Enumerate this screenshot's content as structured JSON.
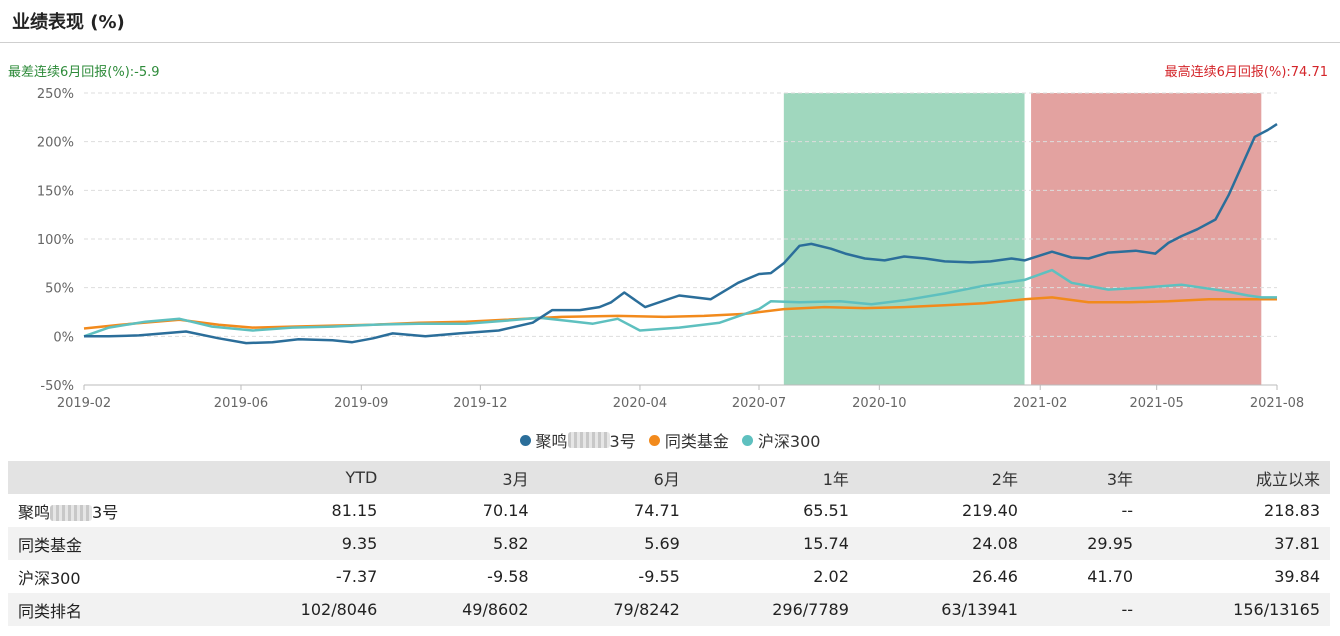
{
  "header": {
    "title": "业绩表现 (%)"
  },
  "stats": {
    "worst": "最差连续6月回报(%):-5.9",
    "best": "最高连续6月回报(%):74.71"
  },
  "chart_data": {
    "type": "line",
    "x_ticks": [
      "2019-02",
      "2019-06",
      "2019-09",
      "2019-12",
      "2020-04",
      "2020-07",
      "2020-10",
      "2021-02",
      "2021-05",
      "2021-08"
    ],
    "x_range": [
      "2019-02-01",
      "2021-08-01"
    ],
    "y_ticks": [
      "250%",
      "200%",
      "150%",
      "100%",
      "50%",
      "0%",
      "-50%"
    ],
    "ylim": [
      -50,
      250
    ],
    "grid": true,
    "legend_position": "bottom-center",
    "shaded_regions": [
      {
        "kind": "worst-6-month",
        "start": "2020-07-20",
        "end": "2021-01-20",
        "color": "#a0d7be"
      },
      {
        "kind": "best-6-month",
        "start": "2021-01-25",
        "end": "2021-07-20",
        "color": "#e3a2a0"
      }
    ],
    "series": [
      {
        "name": "聚鸣",
        "name_suffix": "3号",
        "color": "#2b6e9a",
        "points": [
          [
            "2019-02-01",
            0
          ],
          [
            "2019-02-20",
            0
          ],
          [
            "2019-03-15",
            1
          ],
          [
            "2019-04-20",
            5
          ],
          [
            "2019-05-15",
            -2
          ],
          [
            "2019-06-05",
            -7
          ],
          [
            "2019-06-25",
            -6
          ],
          [
            "2019-07-15",
            -3
          ],
          [
            "2019-08-10",
            -4
          ],
          [
            "2019-08-25",
            -6
          ],
          [
            "2019-09-10",
            -2
          ],
          [
            "2019-09-25",
            3
          ],
          [
            "2019-10-20",
            0
          ],
          [
            "2019-11-15",
            3
          ],
          [
            "2019-12-15",
            6
          ],
          [
            "2020-01-10",
            14
          ],
          [
            "2020-01-25",
            27
          ],
          [
            "2020-02-15",
            27
          ],
          [
            "2020-03-01",
            30
          ],
          [
            "2020-03-10",
            35
          ],
          [
            "2020-03-20",
            45
          ],
          [
            "2020-04-05",
            30
          ],
          [
            "2020-05-01",
            42
          ],
          [
            "2020-05-25",
            38
          ],
          [
            "2020-06-15",
            55
          ],
          [
            "2020-07-01",
            64
          ],
          [
            "2020-07-10",
            65
          ],
          [
            "2020-07-20",
            75
          ],
          [
            "2020-08-01",
            93
          ],
          [
            "2020-08-10",
            95
          ],
          [
            "2020-08-25",
            90
          ],
          [
            "2020-09-05",
            85
          ],
          [
            "2020-09-20",
            80
          ],
          [
            "2020-10-05",
            78
          ],
          [
            "2020-10-20",
            82
          ],
          [
            "2020-11-05",
            80
          ],
          [
            "2020-11-20",
            77
          ],
          [
            "2020-12-10",
            76
          ],
          [
            "2020-12-25",
            77
          ],
          [
            "2021-01-10",
            80
          ],
          [
            "2021-01-20",
            78
          ],
          [
            "2021-02-10",
            87
          ],
          [
            "2021-02-25",
            81
          ],
          [
            "2021-03-10",
            80
          ],
          [
            "2021-03-25",
            86
          ],
          [
            "2021-04-15",
            88
          ],
          [
            "2021-04-30",
            85
          ],
          [
            "2021-05-10",
            96
          ],
          [
            "2021-05-20",
            103
          ],
          [
            "2021-06-01",
            110
          ],
          [
            "2021-06-15",
            120
          ],
          [
            "2021-06-25",
            145
          ],
          [
            "2021-07-05",
            175
          ],
          [
            "2021-07-15",
            205
          ],
          [
            "2021-07-25",
            212
          ],
          [
            "2021-08-01",
            218
          ]
        ]
      },
      {
        "name": "同类基金",
        "color": "#f28a1c",
        "points": [
          [
            "2019-02-01",
            8
          ],
          [
            "2019-03-01",
            12
          ],
          [
            "2019-04-15",
            17
          ],
          [
            "2019-05-15",
            12
          ],
          [
            "2019-06-10",
            9
          ],
          [
            "2019-07-10",
            10
          ],
          [
            "2019-08-10",
            11
          ],
          [
            "2019-09-10",
            12
          ],
          [
            "2019-10-15",
            14
          ],
          [
            "2019-11-20",
            15
          ],
          [
            "2019-12-20",
            17
          ],
          [
            "2020-02-01",
            20
          ],
          [
            "2020-03-15",
            21
          ],
          [
            "2020-04-20",
            20
          ],
          [
            "2020-05-20",
            21
          ],
          [
            "2020-06-20",
            23
          ],
          [
            "2020-07-20",
            28
          ],
          [
            "2020-08-20",
            30
          ],
          [
            "2020-09-20",
            29
          ],
          [
            "2020-10-20",
            30
          ],
          [
            "2020-11-20",
            32
          ],
          [
            "2020-12-20",
            34
          ],
          [
            "2021-01-20",
            38
          ],
          [
            "2021-02-10",
            40
          ],
          [
            "2021-03-10",
            35
          ],
          [
            "2021-04-10",
            35
          ],
          [
            "2021-05-10",
            36
          ],
          [
            "2021-06-10",
            38
          ],
          [
            "2021-07-10",
            38
          ],
          [
            "2021-08-01",
            38
          ]
        ]
      },
      {
        "name": "沪深300",
        "color": "#5ec0bf",
        "points": [
          [
            "2019-02-01",
            0
          ],
          [
            "2019-02-20",
            9
          ],
          [
            "2019-03-20",
            15
          ],
          [
            "2019-04-15",
            18
          ],
          [
            "2019-05-10",
            10
          ],
          [
            "2019-06-10",
            6
          ],
          [
            "2019-07-10",
            9
          ],
          [
            "2019-08-10",
            10
          ],
          [
            "2019-09-10",
            12
          ],
          [
            "2019-10-15",
            13
          ],
          [
            "2019-11-20",
            13
          ],
          [
            "2019-12-20",
            16
          ],
          [
            "2020-01-15",
            19
          ],
          [
            "2020-02-05",
            16
          ],
          [
            "2020-02-25",
            13
          ],
          [
            "2020-03-15",
            18
          ],
          [
            "2020-04-01",
            6
          ],
          [
            "2020-05-01",
            9
          ],
          [
            "2020-06-01",
            14
          ],
          [
            "2020-07-01",
            28
          ],
          [
            "2020-07-10",
            36
          ],
          [
            "2020-08-01",
            35
          ],
          [
            "2020-09-01",
            36
          ],
          [
            "2020-09-25",
            33
          ],
          [
            "2020-10-20",
            37
          ],
          [
            "2020-11-20",
            44
          ],
          [
            "2020-12-20",
            52
          ],
          [
            "2021-01-20",
            58
          ],
          [
            "2021-02-10",
            68
          ],
          [
            "2021-02-25",
            55
          ],
          [
            "2021-03-25",
            48
          ],
          [
            "2021-04-20",
            50
          ],
          [
            "2021-05-20",
            53
          ],
          [
            "2021-06-20",
            47
          ],
          [
            "2021-07-10",
            42
          ],
          [
            "2021-07-20",
            40
          ],
          [
            "2021-08-01",
            40
          ]
        ]
      }
    ]
  },
  "table": {
    "headers": [
      "",
      "YTD",
      "3月",
      "6月",
      "1年",
      "2年",
      "3年",
      "成立以来"
    ],
    "rows": [
      {
        "name": "聚鸣",
        "name_suffix": "3号",
        "values": [
          "81.15",
          "70.14",
          "74.71",
          "65.51",
          "219.40",
          "--",
          "218.83"
        ]
      },
      {
        "name": "同类基金",
        "values": [
          "9.35",
          "5.82",
          "5.69",
          "15.74",
          "24.08",
          "29.95",
          "37.81"
        ]
      },
      {
        "name": "沪深300",
        "values": [
          "-7.37",
          "-9.58",
          "-9.55",
          "2.02",
          "26.46",
          "41.70",
          "39.84"
        ]
      },
      {
        "name": "同类排名",
        "values": [
          "102/8046",
          "49/8602",
          "79/8242",
          "296/7789",
          "63/13941",
          "--",
          "156/13165"
        ]
      }
    ]
  }
}
